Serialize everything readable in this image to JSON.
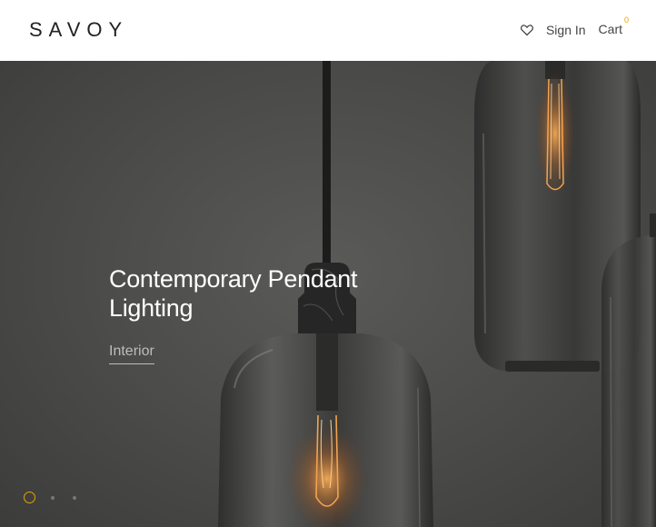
{
  "header": {
    "logo": "SAVOY",
    "nav": {
      "wishlist_icon": "heart-icon",
      "sign_in": "Sign In",
      "cart": "Cart",
      "cart_count": "0"
    }
  },
  "hero": {
    "title": "Contemporary Pendant Lighting",
    "category": "Interior",
    "slides": {
      "total": 3,
      "active": 1
    }
  },
  "colors": {
    "accent": "#e8a400",
    "hero_background": "#4a4a49",
    "text_dark": "#222222"
  }
}
